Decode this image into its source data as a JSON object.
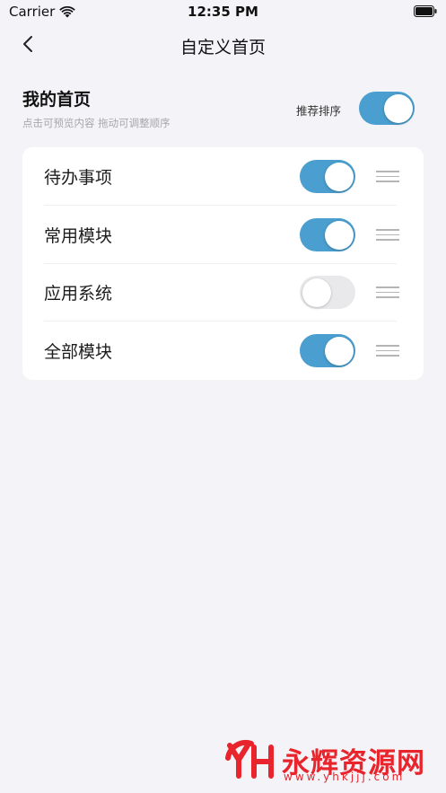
{
  "status_bar": {
    "carrier": "Carrier",
    "time": "12:35 PM"
  },
  "nav": {
    "title": "自定义首页"
  },
  "home_section": {
    "title": "我的首页",
    "subtitle": "点击可预览内容 拖动可调整顺序",
    "sort_label": "推荐排序",
    "sort_enabled": true
  },
  "modules": [
    {
      "label": "待办事项",
      "enabled": true
    },
    {
      "label": "常用模块",
      "enabled": true
    },
    {
      "label": "应用系统",
      "enabled": false
    },
    {
      "label": "全部模块",
      "enabled": true
    }
  ],
  "watermark": {
    "text": "永辉资源网",
    "url": "www.yhkjjj.com"
  },
  "colors": {
    "accent": "#4a9fd0",
    "toggle_off": "#e9e9ec",
    "background": "#f4f4f8",
    "watermark": "#e8242c"
  }
}
